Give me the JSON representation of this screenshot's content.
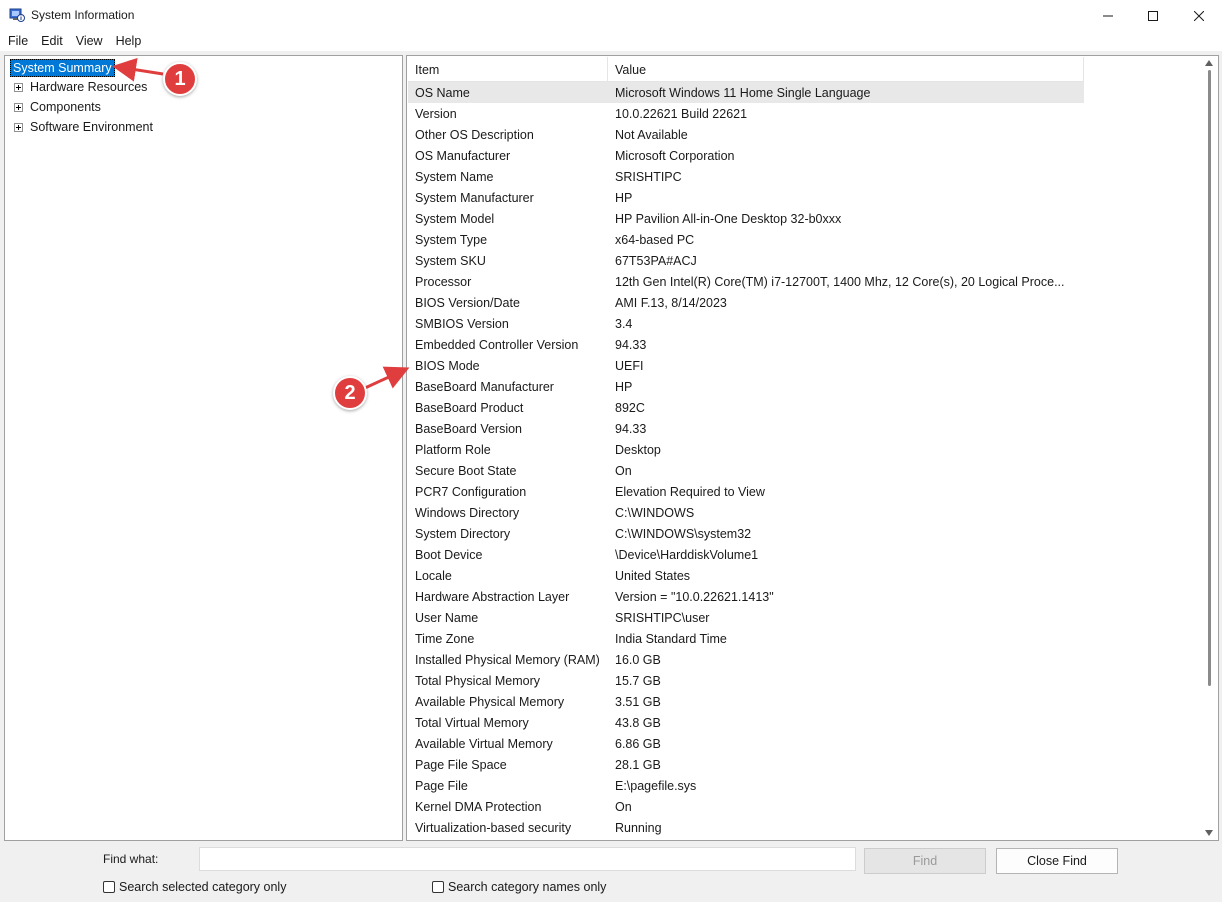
{
  "window": {
    "title": "System Information",
    "icon": "system-info-icon",
    "controls": [
      "minimize-icon",
      "maximize-icon",
      "close-icon"
    ]
  },
  "menu": [
    "File",
    "Edit",
    "View",
    "Help"
  ],
  "tree": {
    "root": "System Summary",
    "children": [
      "Hardware Resources",
      "Components",
      "Software Environment"
    ]
  },
  "list": {
    "header_item": "Item",
    "header_value": "Value",
    "rows": [
      {
        "item": "OS Name",
        "value": "Microsoft Windows 11 Home Single Language"
      },
      {
        "item": "Version",
        "value": "10.0.22621 Build 22621"
      },
      {
        "item": "Other OS Description",
        "value": "Not Available"
      },
      {
        "item": "OS Manufacturer",
        "value": "Microsoft Corporation"
      },
      {
        "item": "System Name",
        "value": "SRISHTIPC"
      },
      {
        "item": "System Manufacturer",
        "value": "HP"
      },
      {
        "item": "System Model",
        "value": "HP Pavilion All-in-One Desktop 32-b0xxx"
      },
      {
        "item": "System Type",
        "value": "x64-based PC"
      },
      {
        "item": "System SKU",
        "value": "67T53PA#ACJ"
      },
      {
        "item": "Processor",
        "value": "12th Gen Intel(R) Core(TM) i7-12700T, 1400 Mhz, 12 Core(s), 20 Logical Proce..."
      },
      {
        "item": "BIOS Version/Date",
        "value": "AMI F.13, 8/14/2023"
      },
      {
        "item": "SMBIOS Version",
        "value": "3.4"
      },
      {
        "item": "Embedded Controller Version",
        "value": "94.33"
      },
      {
        "item": "BIOS Mode",
        "value": "UEFI"
      },
      {
        "item": "BaseBoard Manufacturer",
        "value": "HP"
      },
      {
        "item": "BaseBoard Product",
        "value": "892C"
      },
      {
        "item": "BaseBoard Version",
        "value": "94.33"
      },
      {
        "item": "Platform Role",
        "value": "Desktop"
      },
      {
        "item": "Secure Boot State",
        "value": "On"
      },
      {
        "item": "PCR7 Configuration",
        "value": "Elevation Required to View"
      },
      {
        "item": "Windows Directory",
        "value": "C:\\WINDOWS"
      },
      {
        "item": "System Directory",
        "value": "C:\\WINDOWS\\system32"
      },
      {
        "item": "Boot Device",
        "value": "\\Device\\HarddiskVolume1"
      },
      {
        "item": "Locale",
        "value": "United States"
      },
      {
        "item": "Hardware Abstraction Layer",
        "value": "Version = \"10.0.22621.1413\""
      },
      {
        "item": "User Name",
        "value": "SRISHTIPC\\user"
      },
      {
        "item": "Time Zone",
        "value": "India Standard Time"
      },
      {
        "item": "Installed Physical Memory (RAM)",
        "value": "16.0 GB"
      },
      {
        "item": "Total Physical Memory",
        "value": "15.7 GB"
      },
      {
        "item": "Available Physical Memory",
        "value": "3.51 GB"
      },
      {
        "item": "Total Virtual Memory",
        "value": "43.8 GB"
      },
      {
        "item": "Available Virtual Memory",
        "value": "6.86 GB"
      },
      {
        "item": "Page File Space",
        "value": "28.1 GB"
      },
      {
        "item": "Page File",
        "value": "E:\\pagefile.sys"
      },
      {
        "item": "Kernel DMA Protection",
        "value": "On"
      },
      {
        "item": "Virtualization-based security",
        "value": "Running"
      }
    ]
  },
  "find": {
    "label": "Find what:",
    "value": "",
    "find_button": "Find",
    "close_button": "Close Find",
    "check_selected": "Search selected category only",
    "check_names": "Search category names only"
  },
  "annotations": {
    "marker_1": "1",
    "marker_2": "2",
    "color": "#e03e3e"
  }
}
